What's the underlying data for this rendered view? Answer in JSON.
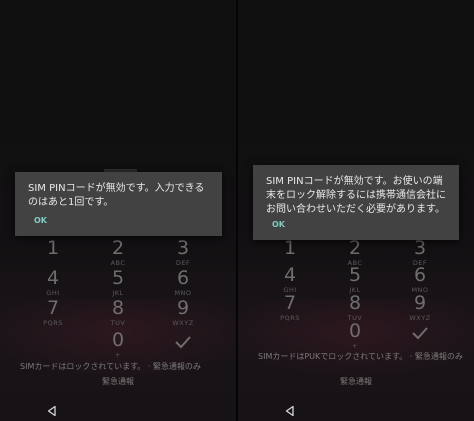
{
  "screens": [
    {
      "dialog": {
        "message": "SIM PINコードが無効です。入力できるのはあと1回です。",
        "ok_label": "OK"
      },
      "status_text": "SIMカードはロックされています。 · 緊急通報のみ",
      "emergency_label": "緊急通報"
    },
    {
      "dialog": {
        "message": "SIM PINコードが無効です。お使いの端末をロック解除するには携帯通信会社にお問い合わせいただく必要があります。",
        "ok_label": "OK"
      },
      "status_text": "SIMカードはPUKでロックされています。 · 緊急通報のみ",
      "emergency_label": "緊急通報"
    }
  ],
  "keypad": [
    {
      "digit": "1",
      "letters": ""
    },
    {
      "digit": "2",
      "letters": "ABC"
    },
    {
      "digit": "3",
      "letters": "DEF"
    },
    {
      "digit": "4",
      "letters": "GHI"
    },
    {
      "digit": "5",
      "letters": "JKL"
    },
    {
      "digit": "6",
      "letters": "MNO"
    },
    {
      "digit": "7",
      "letters": "PQRS"
    },
    {
      "digit": "8",
      "letters": "TUV"
    },
    {
      "digit": "9",
      "letters": "WXYZ"
    },
    {
      "digit": "0",
      "letters": "+"
    }
  ],
  "icons": {
    "enter": "checkmark-icon",
    "back": "back-triangle-icon"
  },
  "colors": {
    "dialog_bg": "#424242",
    "dialog_text": "#e9e9e9",
    "accent": "#80cbc4",
    "background": "#101010"
  }
}
